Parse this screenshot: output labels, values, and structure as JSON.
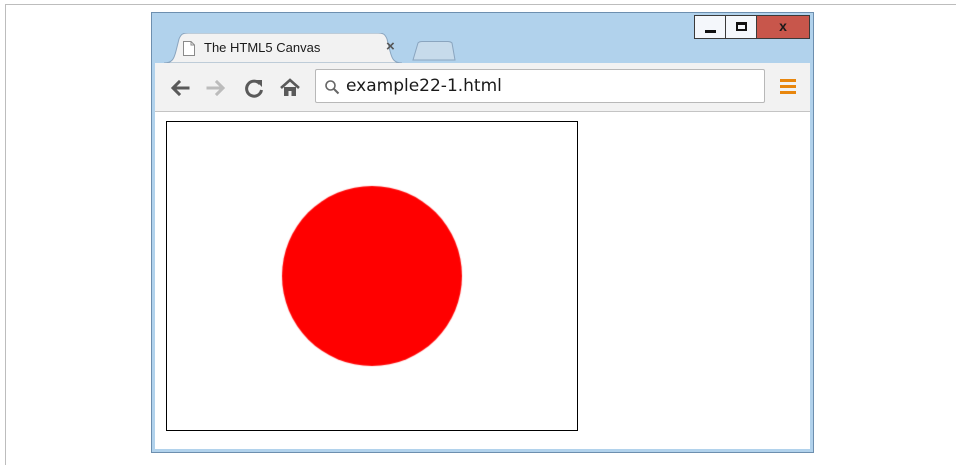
{
  "window": {
    "controls": {
      "close_label": "x"
    }
  },
  "tab": {
    "title": "The HTML5 Canvas",
    "close_label": "×"
  },
  "toolbar": {
    "address": {
      "value": "example22-1.html"
    }
  },
  "canvas": {
    "shape": "circle",
    "fill_color": "#ff0000",
    "border_color": "#000000"
  },
  "colors": {
    "titlebar": "#b1d2ec",
    "close_button": "#c8564b",
    "menu_icon": "#e8860d"
  }
}
